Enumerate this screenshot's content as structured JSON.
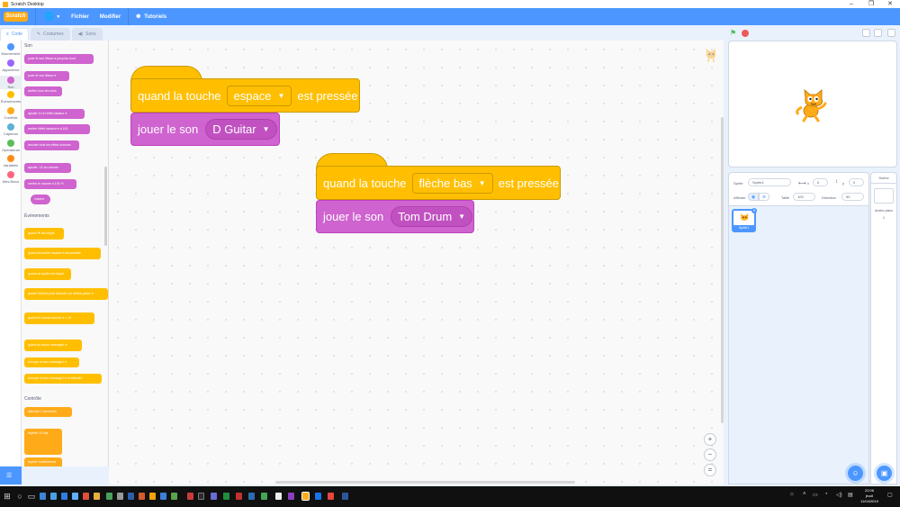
{
  "window": {
    "title": "Scratch Desktop",
    "controls": [
      "–",
      "❐",
      "✕"
    ]
  },
  "menubar": {
    "logo": "Scratch",
    "language_icon": "globe-icon",
    "file": "Fichier",
    "edit": "Modifier",
    "tutorials": "Tutoriels"
  },
  "tabs": [
    {
      "label": "Code",
      "icon": "code-icon"
    },
    {
      "label": "Costumes",
      "icon": "brush-icon"
    },
    {
      "label": "Sons",
      "icon": "speaker-icon"
    }
  ],
  "categories": [
    {
      "label": "Mouvement",
      "color": "#4c97ff"
    },
    {
      "label": "Apparence",
      "color": "#9966ff"
    },
    {
      "label": "Son",
      "color": "#cf63cf"
    },
    {
      "label": "Événements",
      "color": "#ffbf00"
    },
    {
      "label": "Contrôle",
      "color": "#ffab19"
    },
    {
      "label": "Capteurs",
      "color": "#5cb1d6"
    },
    {
      "label": "Opérateurs",
      "color": "#59c059"
    },
    {
      "label": "Variables",
      "color": "#ff8c1a"
    },
    {
      "label": "Mes Blocs",
      "color": "#ff6680"
    }
  ],
  "palette": {
    "sound_title": "Son",
    "sound_blocks": [
      "jouer le son Miaou ▾ jusqu'au bout",
      "jouer le son Miaou ▾",
      "arrêter tous les sons",
      "ajouter 10 à l'effet hauteur ▾",
      "mettre l'effet hauteur ▾ à 100",
      "annuler tous les effets sonores",
      "ajouter -10 au volume",
      "mettre le volume à 100 %",
      "volume"
    ],
    "events_title": "Événements",
    "event_blocks": [
      "quand ⚑ est cliqué",
      "quand la touche espace ▾ est pressée",
      "quand ce sprite est cliqué",
      "quand l'arrière-plan bascule sur arrière-plan1 ▾",
      "quand le volume sonore ▾ > 10",
      "quand je reçois message1 ▾",
      "envoyer à tous message1 ▾",
      "envoyer à tous message1 ▾ et attendre"
    ],
    "control_title": "Contrôle",
    "control_blocks": [
      "attendre 1 secondes",
      "répéter 10 fois",
      "répéter indéfiniment"
    ]
  },
  "scripts": [
    {
      "hat_prefix": "quand la touche",
      "hat_key": "espace",
      "hat_suffix": "est pressée",
      "stack_label": "jouer le son",
      "stack_sound": "D Guitar"
    },
    {
      "hat_prefix": "quand la touche",
      "hat_key": "flèche bas",
      "hat_suffix": "est pressée",
      "stack_label": "jouer le son",
      "stack_sound": "Tom Drum"
    }
  ],
  "zoom": {
    "in": "+",
    "out": "−",
    "reset": "="
  },
  "sprite_info": {
    "sprite_label": "Sprite",
    "sprite_name": "Sprite1",
    "x_label": "x",
    "x_value": "0",
    "y_label": "y",
    "y_value": "0",
    "show_label": "Afficher",
    "size_label": "Taille",
    "size_value": "100",
    "direction_label": "Direction",
    "direction_value": "90"
  },
  "sprite_list": [
    {
      "name": "Sprite1"
    }
  ],
  "stage_pane": {
    "title": "Scène",
    "backdrops_label": "Arrière-plans",
    "backdrops_count": "1"
  },
  "taskbar": {
    "time": "22:06",
    "day": "jeudi",
    "date": "11/04/2019"
  }
}
